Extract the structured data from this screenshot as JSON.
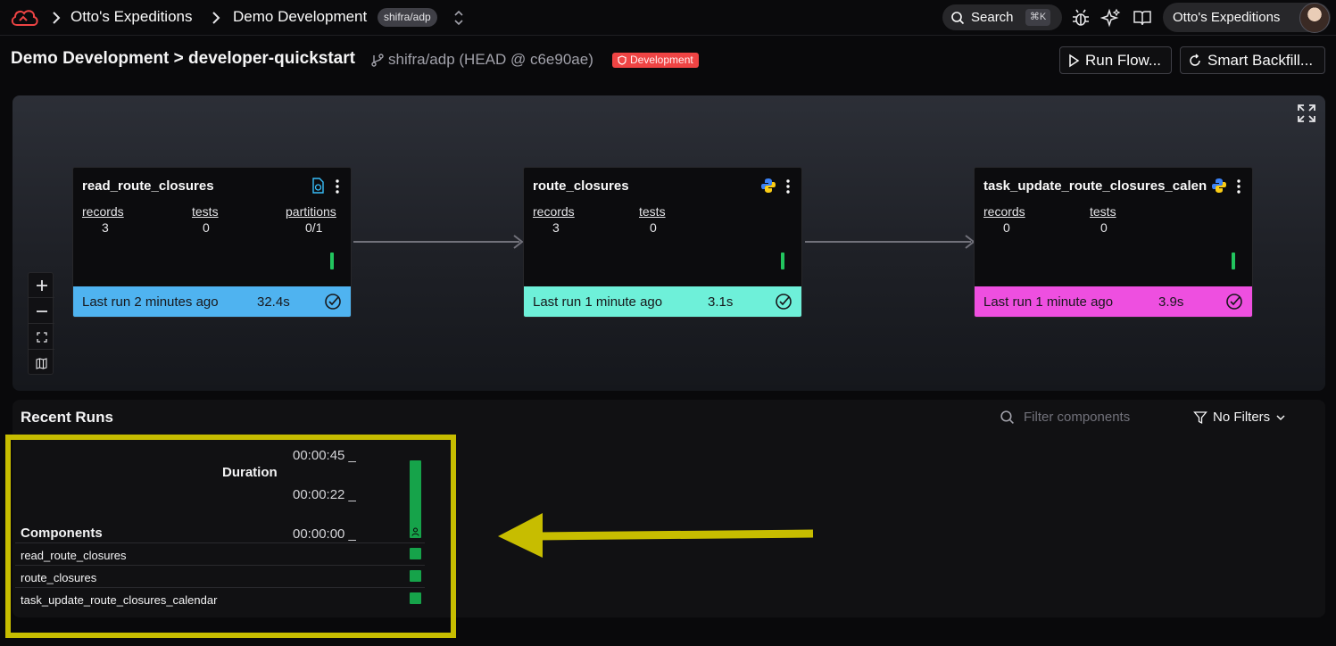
{
  "nav": {
    "org": "Otto's Expeditions",
    "deployment": "Demo Development",
    "branch_pill": "shifra/adp",
    "search_label": "Search",
    "search_shortcut": "⌘K",
    "org_button": "Otto's Expeditions"
  },
  "header": {
    "deployment": "Demo Development",
    "separator": ">",
    "flow": "developer-quickstart",
    "branch": "shifra/adp (HEAD @ c6e90ae)",
    "env_badge": "Development",
    "run_flow": "Run Flow...",
    "smart_backfill": "Smart Backfill..."
  },
  "nodes": [
    {
      "name": "read_route_closures",
      "kind_icon": "file-sync-icon",
      "metrics": [
        {
          "label": "records",
          "value": "3"
        },
        {
          "label": "tests",
          "value": "0"
        },
        {
          "label": "partitions",
          "value": "0/1"
        }
      ],
      "last_run": "Last run 2 minutes ago",
      "duration": "32.4s",
      "color": "#4fb3f0"
    },
    {
      "name": "route_closures",
      "kind_icon": "python-icon",
      "metrics": [
        {
          "label": "records",
          "value": "3"
        },
        {
          "label": "tests",
          "value": "0"
        }
      ],
      "last_run": "Last run 1 minute ago",
      "duration": "3.1s",
      "color": "#6ef0d9"
    },
    {
      "name": "task_update_route_closures_calendar",
      "kind_icon": "python-icon",
      "metrics": [
        {
          "label": "records",
          "value": "0"
        },
        {
          "label": "tests",
          "value": "0"
        }
      ],
      "last_run": "Last run 1 minute ago",
      "duration": "3.9s",
      "color": "#ee4fe0"
    }
  ],
  "recent_runs": {
    "title": "Recent Runs",
    "filter_placeholder": "Filter components",
    "no_filters": "No Filters",
    "duration_label": "Duration",
    "ticks": [
      "00:00:45 _",
      "00:00:22 _",
      "00:00:00 _"
    ],
    "components_header": "Components",
    "components": [
      "read_route_closures",
      "route_closures",
      "task_update_route_closures_calendar"
    ],
    "status_color": "#16a34a"
  },
  "annotation": {
    "highlight_color": "#c7bd00"
  }
}
